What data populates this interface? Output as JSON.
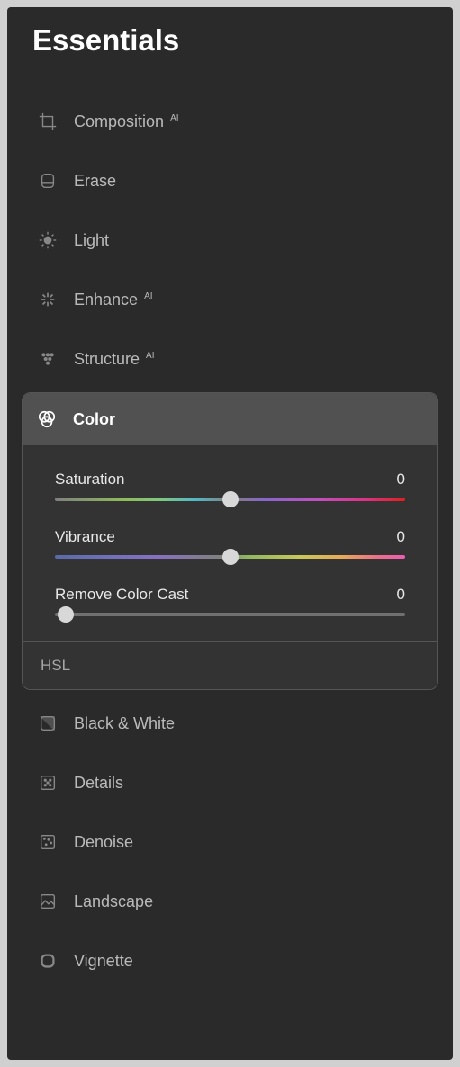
{
  "header": {
    "title": "Essentials"
  },
  "tools": {
    "composition": {
      "label": "Composition",
      "ai": "AI"
    },
    "erase": {
      "label": "Erase"
    },
    "light": {
      "label": "Light"
    },
    "enhance": {
      "label": "Enhance",
      "ai": "AI"
    },
    "structure": {
      "label": "Structure",
      "ai": "AI"
    },
    "color": {
      "label": "Color"
    },
    "hsl": {
      "label": "HSL"
    },
    "bw": {
      "label": "Black & White"
    },
    "details": {
      "label": "Details"
    },
    "denoise": {
      "label": "Denoise"
    },
    "landscape": {
      "label": "Landscape"
    },
    "vignette": {
      "label": "Vignette"
    }
  },
  "color_controls": {
    "saturation": {
      "label": "Saturation",
      "value": "0",
      "position": 50
    },
    "vibrance": {
      "label": "Vibrance",
      "value": "0",
      "position": 50
    },
    "remove_color_cast": {
      "label": "Remove Color Cast",
      "value": "0",
      "position": 3
    }
  }
}
